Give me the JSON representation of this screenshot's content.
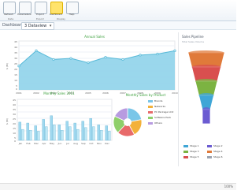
{
  "ribbon": {
    "buttons": [
      {
        "label": "Refresh",
        "active": false
      },
      {
        "label": "Parameters",
        "active": false
      },
      {
        "label": "Export",
        "active": false
      },
      {
        "label": "Dashboard",
        "active": true
      },
      {
        "label": "Help",
        "active": false
      }
    ],
    "groups": [
      "Data",
      "Export",
      "Display"
    ]
  },
  "toolbar": {
    "label": "Dashboard",
    "selected": "3 Dataview"
  },
  "charts": {
    "annual": {
      "title": "Annual Sales",
      "ylabel": "$ (M)",
      "years": [
        "2001",
        "2002",
        "2003",
        "2004",
        "2005",
        "2006",
        "2007",
        "2008",
        "2009",
        "2010"
      ],
      "yticks": [
        "45",
        "40",
        "35",
        "30",
        "25",
        "20",
        "15",
        "10",
        "5",
        "0"
      ]
    },
    "monthly": {
      "title": "Monthly Sales 2011",
      "ylabel": "$ (M)",
      "months": [
        "Jan",
        "Feb",
        "Mar",
        "Apr",
        "May",
        "Jun",
        "Jul",
        "Aug",
        "Sep",
        "Oct",
        "Nov",
        "Dec"
      ],
      "yticks": [
        "45",
        "40",
        "35",
        "30",
        "25",
        "20",
        "15",
        "10",
        "5",
        "0"
      ]
    },
    "product": {
      "title": "Monthly Sales by Product",
      "legend": [
        "Brands",
        "Networks",
        "PC Package Unit",
        "Software Pack",
        "Others"
      ]
    }
  },
  "right_panel": {
    "title": "Sales Pipeline",
    "subtitle": "Total Sales Volume",
    "legend": [
      "Stage 1",
      "Stage 2",
      "Stage 3",
      "Stage 4",
      "Stage 5",
      "Stage 6"
    ]
  },
  "status": {
    "zoom": "100%"
  },
  "colors": {
    "area": "#8fd3ea",
    "area_stroke": "#57b9d8",
    "bars": "#9fd8ef",
    "accent": "#3a9f3a",
    "funnel": [
      "#e07a3a",
      "#d94f4f",
      "#7cb342",
      "#3fa6d6",
      "#6b5bd1"
    ],
    "pie": [
      "#7ac6e8",
      "#f3b13a",
      "#e86a6a",
      "#8fcf6a",
      "#b89be0"
    ]
  },
  "chart_data": [
    {
      "type": "area",
      "title": "Annual Sales",
      "x": [
        "2001",
        "2002",
        "2003",
        "2004",
        "2005",
        "2006",
        "2007",
        "2008",
        "2009",
        "2010"
      ],
      "y": [
        22,
        36,
        28,
        29,
        25,
        30,
        28,
        32,
        33,
        36
      ],
      "xlabel": "",
      "ylabel": "$ (M)",
      "ylim": [
        0,
        45
      ]
    },
    {
      "type": "bar",
      "title": "Monthly Sales 2011",
      "categories": [
        "Jan",
        "Feb",
        "Mar",
        "Apr",
        "May",
        "Jun",
        "Jul",
        "Aug",
        "Sep",
        "Oct",
        "Nov",
        "Dec"
      ],
      "series": [
        {
          "values": [
            20,
            19,
            16,
            23,
            27,
            17,
            21,
            19,
            21,
            24,
            17,
            16
          ]
        },
        {
          "values": [
            12,
            11,
            10,
            15,
            17,
            11,
            15,
            12,
            14,
            15,
            11,
            10
          ]
        }
      ],
      "ylabel": "$ (M)",
      "ylim": [
        0,
        45
      ]
    },
    {
      "type": "pie",
      "title": "Monthly Sales by Product",
      "categories": [
        "Brands",
        "Networks",
        "PC Package Unit",
        "Software Pack",
        "Others"
      ],
      "values": [
        22,
        20,
        20,
        20,
        18
      ]
    },
    {
      "type": "funnel",
      "title": "Sales Pipeline",
      "categories": [
        "Stage 1",
        "Stage 2",
        "Stage 3",
        "Stage 4",
        "Stage 5"
      ],
      "values": [
        100,
        78,
        60,
        32,
        10
      ]
    }
  ]
}
